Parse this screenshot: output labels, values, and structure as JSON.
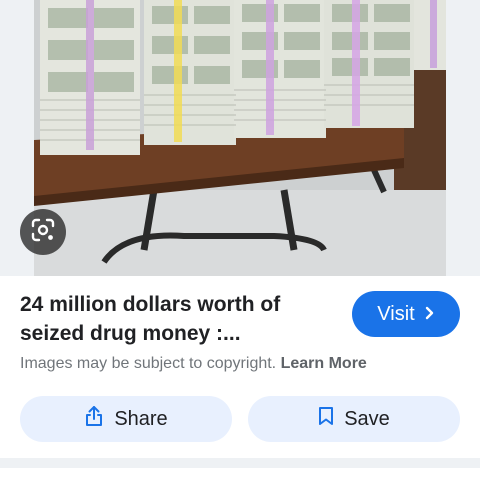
{
  "result": {
    "title": "24 million dollars worth of seized drug money :...",
    "visit_label": "Visit",
    "copyright_text": "Images may be subject to copyright.",
    "learn_more_label": "Learn More"
  },
  "actions": {
    "share_label": "Share",
    "save_label": "Save"
  },
  "colors": {
    "accent": "#1a73e8",
    "button_bg": "#e8f0fe",
    "text_primary": "#202124",
    "text_secondary": "#70757a"
  },
  "icons": [
    "lens-icon",
    "chevron-right-icon",
    "share-icon",
    "bookmark-icon"
  ]
}
